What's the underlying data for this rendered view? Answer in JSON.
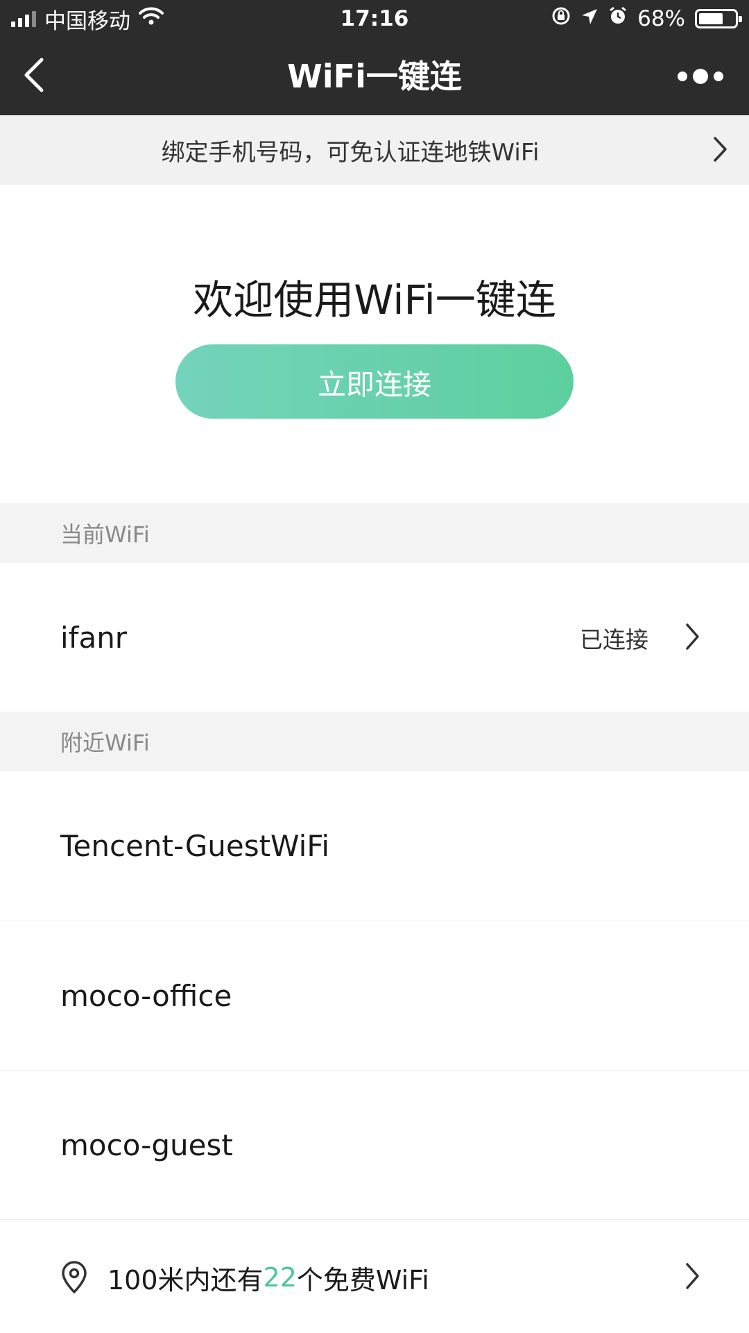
{
  "status_bar": {
    "carrier": "中国移动",
    "time": "17:16",
    "battery": "68%",
    "battery_level": 0.68
  },
  "nav": {
    "title": "WiFi一键连"
  },
  "banner": {
    "text": "绑定手机号码，可免认证连地铁WiFi"
  },
  "hero": {
    "welcome": "欢迎使用WiFi一键连",
    "connect_label": "立即连接",
    "accent_gradient": [
      "#74d3bc",
      "#5dcf9e"
    ]
  },
  "current": {
    "header": "当前WiFi",
    "name": "ifanr",
    "status": "已连接"
  },
  "nearby": {
    "header": "附近WiFi",
    "items": [
      {
        "name": "Tencent-GuestWiFi"
      },
      {
        "name": "moco-office"
      },
      {
        "name": "moco-guest"
      }
    ]
  },
  "footer": {
    "prefix": "100米内还有",
    "count": "22",
    "suffix": "个免费WiFi",
    "count_color": "#4cc59a"
  },
  "icons": [
    "signal-icon",
    "wifi-icon",
    "rotation-lock-icon",
    "location-arrow-icon",
    "alarm-icon",
    "battery-icon",
    "back-icon",
    "more-icon",
    "chevron-right-icon",
    "location-pin-icon"
  ]
}
